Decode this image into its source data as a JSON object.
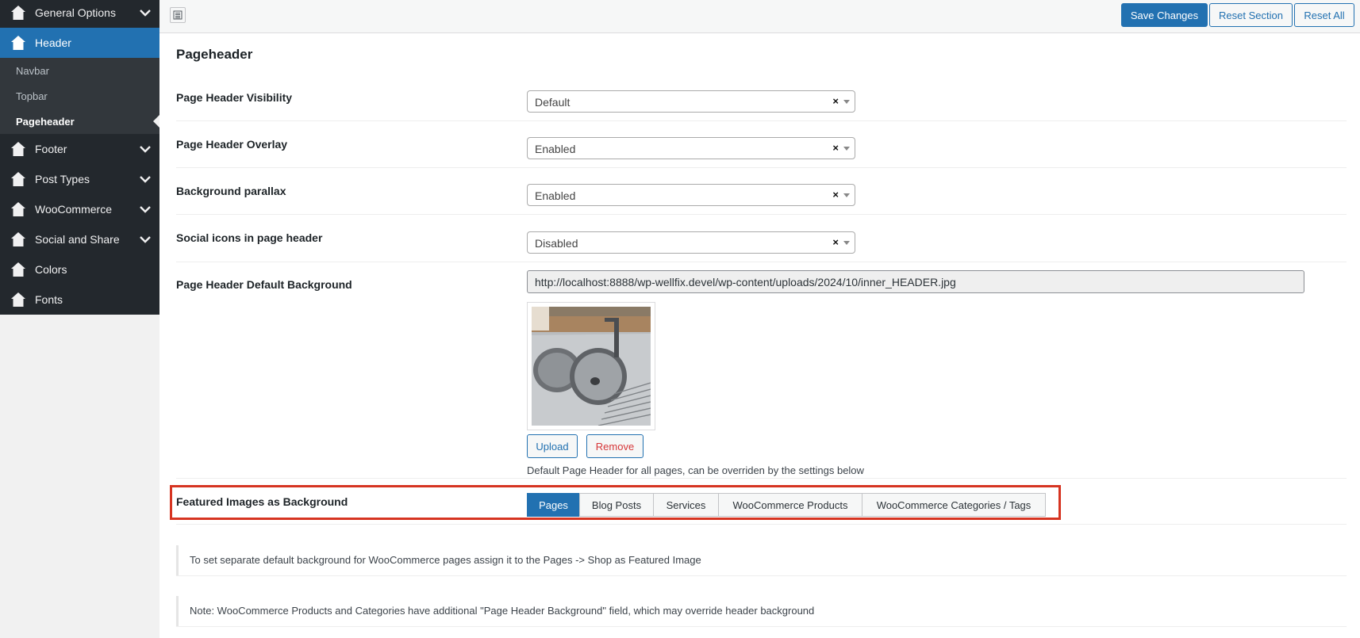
{
  "sidebar": {
    "items": [
      {
        "label": "General Options",
        "has_chevron": true
      },
      {
        "label": "Header",
        "active": true
      },
      {
        "label": "Footer",
        "has_chevron": true
      },
      {
        "label": "Post Types",
        "has_chevron": true
      },
      {
        "label": "WooCommerce",
        "has_chevron": true
      },
      {
        "label": "Social and Share",
        "has_chevron": true
      },
      {
        "label": "Colors"
      },
      {
        "label": "Fonts"
      }
    ],
    "submenu": [
      "Navbar",
      "Topbar",
      "Pageheader"
    ],
    "current_submenu": "Pageheader"
  },
  "toolbar": {
    "save_label": "Save Changes",
    "reset_section_label": "Reset Section",
    "reset_all_label": "Reset All"
  },
  "section": {
    "title": "Pageheader",
    "fields": [
      {
        "label": "Page Header Visibility",
        "value": "Default"
      },
      {
        "label": "Page Header Overlay",
        "value": "Enabled"
      },
      {
        "label": "Background parallax",
        "value": "Enabled"
      },
      {
        "label": "Social icons in page header",
        "value": "Disabled"
      }
    ],
    "background": {
      "label": "Page Header Default Background",
      "url": "http://localhost:8888/wp-wellfix.devel/wp-content/uploads/2024/10/inner_HEADER.jpg",
      "upload_label": "Upload",
      "remove_label": "Remove",
      "description": "Default Page Header for all pages, can be overriden by the settings below"
    },
    "featured": {
      "label": "Featured Images as Background",
      "tabs": [
        "Pages",
        "Blog Posts",
        "Services",
        "WooCommerce Products",
        "WooCommerce Categories / Tags"
      ],
      "active_tab": "Pages"
    },
    "notices": [
      "To set separate default background for WooCommerce pages assign it to the Pages -> Shop as Featured Image",
      "Note: WooCommerce Products and Categories have additional \"Page Header Background\" field, which may override header background"
    ]
  },
  "colors": {
    "accent": "#2271b1",
    "sidebar_bg": "#23282d",
    "highlight_border": "#d63421",
    "remove_text": "#d63638"
  }
}
